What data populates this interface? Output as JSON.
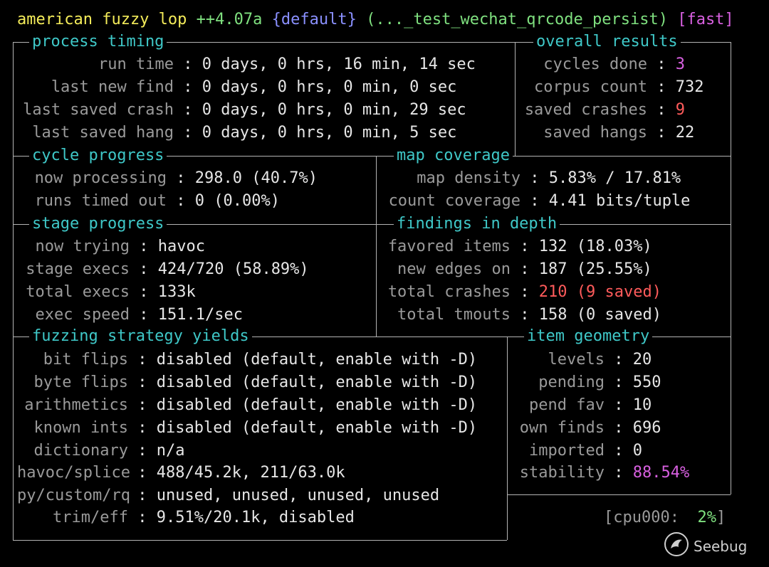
{
  "header": {
    "program": "american fuzzy lop",
    "version": "++4.07a",
    "profile": "{default}",
    "target": "(..._test_wechat_qrcode_persist)",
    "mode": "[fast]"
  },
  "process_timing": {
    "title": "process timing",
    "run_time_label": "run time",
    "run_time": "0 days, 0 hrs, 16 min, 14 sec",
    "last_new_find_label": "last new find",
    "last_new_find": "0 days, 0 hrs, 0 min, 0 sec",
    "last_saved_crash_label": "last saved crash",
    "last_saved_crash": "0 days, 0 hrs, 0 min, 29 sec",
    "last_saved_hang_label": "last saved hang",
    "last_saved_hang": "0 days, 0 hrs, 0 min, 5 sec"
  },
  "overall_results": {
    "title": "overall results",
    "cycles_done_label": "cycles done",
    "cycles_done": "3",
    "corpus_count_label": "corpus count",
    "corpus_count": "732",
    "saved_crashes_label": "saved crashes",
    "saved_crashes": "9",
    "saved_hangs_label": "saved hangs",
    "saved_hangs": "22"
  },
  "cycle_progress": {
    "title": "cycle progress",
    "now_processing_label": "now processing",
    "now_processing": "298.0 (40.7%)",
    "runs_timed_out_label": "runs timed out",
    "runs_timed_out": "0 (0.00%)"
  },
  "map_coverage": {
    "title": "map coverage",
    "map_density_label": "map density",
    "map_density": "5.83% / 17.81%",
    "count_coverage_label": "count coverage",
    "count_coverage": "4.41 bits/tuple"
  },
  "stage_progress": {
    "title": "stage progress",
    "now_trying_label": "now trying",
    "now_trying": "havoc",
    "stage_execs_label": "stage execs",
    "stage_execs": "424/720 (58.89%)",
    "total_execs_label": "total execs",
    "total_execs": "133k",
    "exec_speed_label": "exec speed",
    "exec_speed": "151.1/sec"
  },
  "findings_in_depth": {
    "title": "findings in depth",
    "favored_items_label": "favored items",
    "favored_items": "132 (18.03%)",
    "new_edges_on_label": "new edges on",
    "new_edges_on": "187 (25.55%)",
    "total_crashes_label": "total crashes",
    "total_crashes": "210 (9 saved)",
    "total_tmouts_label": "total tmouts",
    "total_tmouts": "158 (0 saved)"
  },
  "fuzzing_strategy_yields": {
    "title": "fuzzing strategy yields",
    "bit_flips_label": "bit flips",
    "bit_flips": "disabled (default, enable with -D)",
    "byte_flips_label": "byte flips",
    "byte_flips": "disabled (default, enable with -D)",
    "arithmetics_label": "arithmetics",
    "arithmetics": "disabled (default, enable with -D)",
    "known_ints_label": "known ints",
    "known_ints": "disabled (default, enable with -D)",
    "dictionary_label": "dictionary",
    "dictionary": "n/a",
    "havoc_splice_label": "havoc/splice",
    "havoc_splice": "488/45.2k, 211/63.0k",
    "py_custom_rq_label": "py/custom/rq",
    "py_custom_rq": "unused, unused, unused, unused",
    "trim_eff_label": "trim/eff",
    "trim_eff": "9.51%/20.1k, disabled"
  },
  "item_geometry": {
    "title": "item geometry",
    "levels_label": "levels",
    "levels": "20",
    "pending_label": "pending",
    "pending": "550",
    "pend_fav_label": "pend fav",
    "pend_fav": "10",
    "own_finds_label": "own finds",
    "own_finds": "696",
    "imported_label": "imported",
    "imported": "0",
    "stability_label": "stability",
    "stability": "88.54%"
  },
  "cpu": {
    "prefix": "[cpu000:",
    "value": "2%",
    "suffix": "]"
  },
  "watermark": {
    "text": "Seebug",
    "icon": "seebug-logo-icon"
  },
  "colors": {
    "background": "#000000",
    "border": "#b4b4b4",
    "title": "#3fc8c8",
    "label": "#9a9a9a",
    "value": "#e6e6e6",
    "header": "#f4ec5a",
    "version": "#7fe07f",
    "profile": "#8a90ff",
    "highlight_magenta": "#d860e0",
    "highlight_red": "#ff5b5b"
  }
}
